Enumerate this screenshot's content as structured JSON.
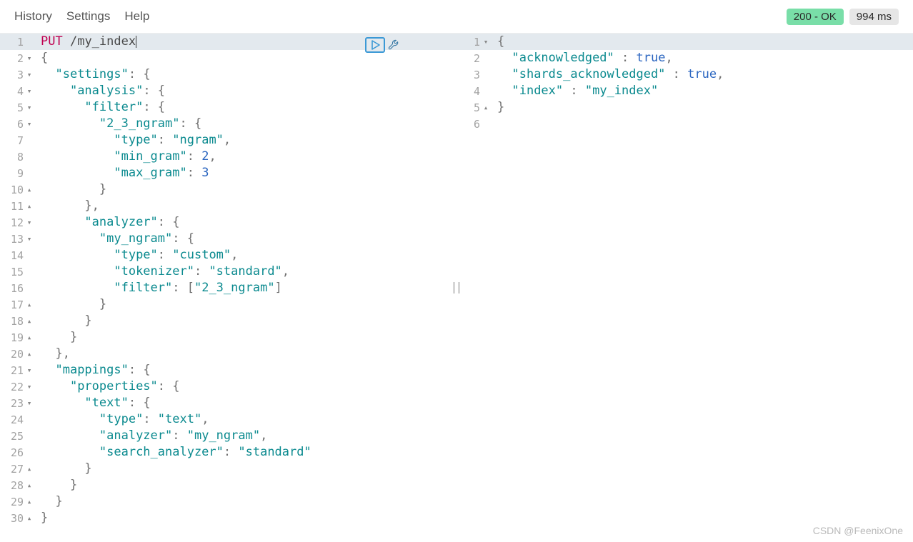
{
  "menu": {
    "history": "History",
    "settings": "Settings",
    "help": "Help"
  },
  "status": {
    "ok": "200 - OK",
    "time": "994 ms"
  },
  "watermark": "CSDN @FeenixOne",
  "left": {
    "lines": [
      {
        "n": 1,
        "fold": "",
        "hl": true,
        "segs": [
          [
            "method",
            "PUT"
          ],
          [
            "punc",
            " "
          ],
          [
            "plain",
            "/my_index"
          ]
        ],
        "cursor": true
      },
      {
        "n": 2,
        "fold": "▾",
        "hl": false,
        "segs": [
          [
            "punc",
            "{"
          ]
        ]
      },
      {
        "n": 3,
        "fold": "▾",
        "hl": false,
        "segs": [
          [
            "punc",
            "  "
          ],
          [
            "key",
            "\"settings\""
          ],
          [
            "punc",
            ": {"
          ]
        ]
      },
      {
        "n": 4,
        "fold": "▾",
        "hl": false,
        "segs": [
          [
            "punc",
            "    "
          ],
          [
            "key",
            "\"analysis\""
          ],
          [
            "punc",
            ": {"
          ]
        ]
      },
      {
        "n": 5,
        "fold": "▾",
        "hl": false,
        "segs": [
          [
            "punc",
            "      "
          ],
          [
            "key",
            "\"filter\""
          ],
          [
            "punc",
            ": {"
          ]
        ]
      },
      {
        "n": 6,
        "fold": "▾",
        "hl": false,
        "segs": [
          [
            "punc",
            "        "
          ],
          [
            "key",
            "\"2_3_ngram\""
          ],
          [
            "punc",
            ": {"
          ]
        ]
      },
      {
        "n": 7,
        "fold": "",
        "hl": false,
        "segs": [
          [
            "punc",
            "          "
          ],
          [
            "key",
            "\"type\""
          ],
          [
            "punc",
            ": "
          ],
          [
            "str",
            "\"ngram\""
          ],
          [
            "punc",
            ","
          ]
        ]
      },
      {
        "n": 8,
        "fold": "",
        "hl": false,
        "segs": [
          [
            "punc",
            "          "
          ],
          [
            "key",
            "\"min_gram\""
          ],
          [
            "punc",
            ": "
          ],
          [
            "num",
            "2"
          ],
          [
            "punc",
            ","
          ]
        ]
      },
      {
        "n": 9,
        "fold": "",
        "hl": false,
        "segs": [
          [
            "punc",
            "          "
          ],
          [
            "key",
            "\"max_gram\""
          ],
          [
            "punc",
            ": "
          ],
          [
            "num",
            "3"
          ]
        ]
      },
      {
        "n": 10,
        "fold": "▴",
        "hl": false,
        "segs": [
          [
            "punc",
            "        }"
          ]
        ]
      },
      {
        "n": 11,
        "fold": "▴",
        "hl": false,
        "segs": [
          [
            "punc",
            "      },"
          ]
        ]
      },
      {
        "n": 12,
        "fold": "▾",
        "hl": false,
        "segs": [
          [
            "punc",
            "      "
          ],
          [
            "key",
            "\"analyzer\""
          ],
          [
            "punc",
            ": {"
          ]
        ]
      },
      {
        "n": 13,
        "fold": "▾",
        "hl": false,
        "segs": [
          [
            "punc",
            "        "
          ],
          [
            "key",
            "\"my_ngram\""
          ],
          [
            "punc",
            ": {"
          ]
        ]
      },
      {
        "n": 14,
        "fold": "",
        "hl": false,
        "segs": [
          [
            "punc",
            "          "
          ],
          [
            "key",
            "\"type\""
          ],
          [
            "punc",
            ": "
          ],
          [
            "str",
            "\"custom\""
          ],
          [
            "punc",
            ","
          ]
        ]
      },
      {
        "n": 15,
        "fold": "",
        "hl": false,
        "segs": [
          [
            "punc",
            "          "
          ],
          [
            "key",
            "\"tokenizer\""
          ],
          [
            "punc",
            ": "
          ],
          [
            "str",
            "\"standard\""
          ],
          [
            "punc",
            ","
          ]
        ]
      },
      {
        "n": 16,
        "fold": "",
        "hl": false,
        "segs": [
          [
            "punc",
            "          "
          ],
          [
            "key",
            "\"filter\""
          ],
          [
            "punc",
            ": ["
          ],
          [
            "str",
            "\"2_3_ngram\""
          ],
          [
            "punc",
            "]"
          ]
        ]
      },
      {
        "n": 17,
        "fold": "▴",
        "hl": false,
        "segs": [
          [
            "punc",
            "        }"
          ]
        ]
      },
      {
        "n": 18,
        "fold": "▴",
        "hl": false,
        "segs": [
          [
            "punc",
            "      }"
          ]
        ]
      },
      {
        "n": 19,
        "fold": "▴",
        "hl": false,
        "segs": [
          [
            "punc",
            "    }"
          ]
        ]
      },
      {
        "n": 20,
        "fold": "▴",
        "hl": false,
        "segs": [
          [
            "punc",
            "  },"
          ]
        ]
      },
      {
        "n": 21,
        "fold": "▾",
        "hl": false,
        "segs": [
          [
            "punc",
            "  "
          ],
          [
            "key",
            "\"mappings\""
          ],
          [
            "punc",
            ": {"
          ]
        ]
      },
      {
        "n": 22,
        "fold": "▾",
        "hl": false,
        "segs": [
          [
            "punc",
            "    "
          ],
          [
            "key",
            "\"properties\""
          ],
          [
            "punc",
            ": {"
          ]
        ]
      },
      {
        "n": 23,
        "fold": "▾",
        "hl": false,
        "segs": [
          [
            "punc",
            "      "
          ],
          [
            "key",
            "\"text\""
          ],
          [
            "punc",
            ": {"
          ]
        ]
      },
      {
        "n": 24,
        "fold": "",
        "hl": false,
        "segs": [
          [
            "punc",
            "        "
          ],
          [
            "key",
            "\"type\""
          ],
          [
            "punc",
            ": "
          ],
          [
            "str",
            "\"text\""
          ],
          [
            "punc",
            ","
          ]
        ]
      },
      {
        "n": 25,
        "fold": "",
        "hl": false,
        "segs": [
          [
            "punc",
            "        "
          ],
          [
            "key",
            "\"analyzer\""
          ],
          [
            "punc",
            ": "
          ],
          [
            "str",
            "\"my_ngram\""
          ],
          [
            "punc",
            ","
          ]
        ]
      },
      {
        "n": 26,
        "fold": "",
        "hl": false,
        "segs": [
          [
            "punc",
            "        "
          ],
          [
            "key",
            "\"search_analyzer\""
          ],
          [
            "punc",
            ": "
          ],
          [
            "str",
            "\"standard\""
          ]
        ]
      },
      {
        "n": 27,
        "fold": "▴",
        "hl": false,
        "segs": [
          [
            "punc",
            "      }"
          ]
        ]
      },
      {
        "n": 28,
        "fold": "▴",
        "hl": false,
        "segs": [
          [
            "punc",
            "    }"
          ]
        ]
      },
      {
        "n": 29,
        "fold": "▴",
        "hl": false,
        "segs": [
          [
            "punc",
            "  }"
          ]
        ]
      },
      {
        "n": 30,
        "fold": "▴",
        "hl": false,
        "segs": [
          [
            "punc",
            "}"
          ]
        ]
      }
    ]
  },
  "right": {
    "lines": [
      {
        "n": 1,
        "fold": "▾",
        "hl": true,
        "segs": [
          [
            "punc",
            "{"
          ]
        ]
      },
      {
        "n": 2,
        "fold": "",
        "hl": false,
        "segs": [
          [
            "punc",
            "  "
          ],
          [
            "key",
            "\"acknowledged\""
          ],
          [
            "punc",
            " : "
          ],
          [
            "bool",
            "true"
          ],
          [
            "punc",
            ","
          ]
        ]
      },
      {
        "n": 3,
        "fold": "",
        "hl": false,
        "segs": [
          [
            "punc",
            "  "
          ],
          [
            "key",
            "\"shards_acknowledged\""
          ],
          [
            "punc",
            " : "
          ],
          [
            "bool",
            "true"
          ],
          [
            "punc",
            ","
          ]
        ]
      },
      {
        "n": 4,
        "fold": "",
        "hl": false,
        "segs": [
          [
            "punc",
            "  "
          ],
          [
            "key",
            "\"index\""
          ],
          [
            "punc",
            " : "
          ],
          [
            "str",
            "\"my_index\""
          ]
        ]
      },
      {
        "n": 5,
        "fold": "▴",
        "hl": false,
        "segs": [
          [
            "punc",
            "}"
          ]
        ]
      },
      {
        "n": 6,
        "fold": "",
        "hl": false,
        "segs": []
      }
    ]
  }
}
